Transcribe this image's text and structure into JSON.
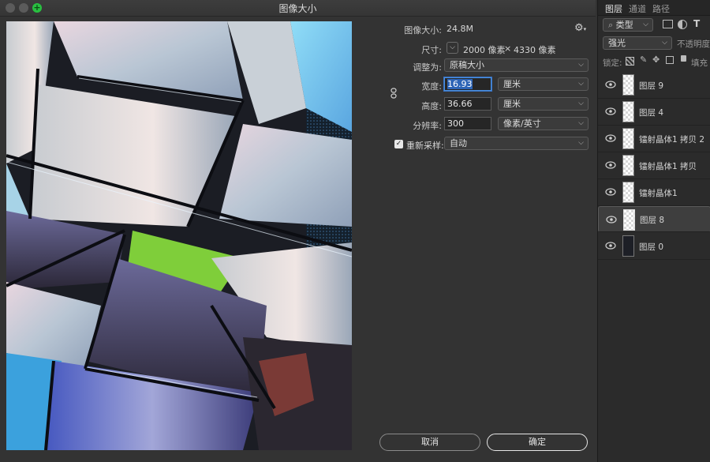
{
  "window": {
    "title": "图像大小"
  },
  "form": {
    "image_size_label": "图像大小:",
    "image_size_value": "24.8M",
    "dimensions_label": "尺寸:",
    "dimensions_width": "2000 像素",
    "dimensions_x": "×",
    "dimensions_height": "4330 像素",
    "fit_to_label": "调整为:",
    "fit_to_value": "原稿大小",
    "width_label": "宽度:",
    "width_value": "16.93",
    "width_unit": "厘米",
    "height_label": "高度:",
    "height_value": "36.66",
    "height_unit": "厘米",
    "resolution_label": "分辨率:",
    "resolution_value": "300",
    "resolution_unit": "像素/英寸",
    "resample_label": "重新采样:",
    "resample_value": "自动",
    "resample_checked": true
  },
  "buttons": {
    "cancel": "取消",
    "ok": "确定"
  },
  "layers_panel": {
    "tabs": [
      "图层",
      "通道",
      "路径"
    ],
    "filter_kind": "类型",
    "blend_mode": "强光",
    "opacity_label": "不透明度",
    "lock_label": "锁定:",
    "fill_label": "填充",
    "layers": [
      {
        "name": "图层 9",
        "selected": false,
        "thumb": "transparent"
      },
      {
        "name": "图层 4",
        "selected": false,
        "thumb": "transparent"
      },
      {
        "name": "镭射晶体1 拷贝 2",
        "selected": false,
        "thumb": "transparent"
      },
      {
        "name": "镭射晶体1 拷贝",
        "selected": false,
        "thumb": "transparent"
      },
      {
        "name": "镭射晶体1",
        "selected": false,
        "thumb": "transparent"
      },
      {
        "name": "图层 8",
        "selected": true,
        "thumb": "transparent"
      },
      {
        "name": "图层 0",
        "selected": false,
        "thumb": "dark"
      }
    ]
  },
  "colors": {
    "accent": "#2d64b6",
    "green_button": "#29c041"
  }
}
